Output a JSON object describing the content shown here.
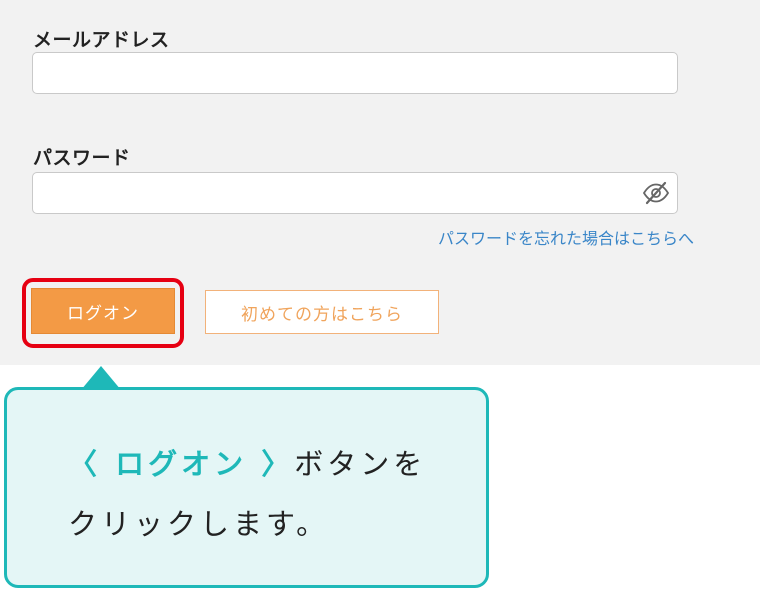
{
  "form": {
    "email_label": "メールアドレス",
    "email_value": "",
    "password_label": "パスワード",
    "password_value": "",
    "password_toggle_icon": "eye-slash-icon",
    "forgot_link": "パスワードを忘れた場合はこちらへ",
    "logon_button": "ログオン",
    "firsttime_button": "初めての方はこちら"
  },
  "callout": {
    "highlight": "〈 ログオン 〉",
    "line1_rest": "ボタンを",
    "line2": "クリックします。"
  },
  "colors": {
    "panel_bg": "#f2f2f2",
    "primary_button": "#f39a45",
    "secondary_button_text": "#f0a45c",
    "link": "#3a86c8",
    "highlight_ring": "#e60012",
    "callout_border": "#1eb8b8",
    "callout_bg": "#e4f6f6"
  }
}
